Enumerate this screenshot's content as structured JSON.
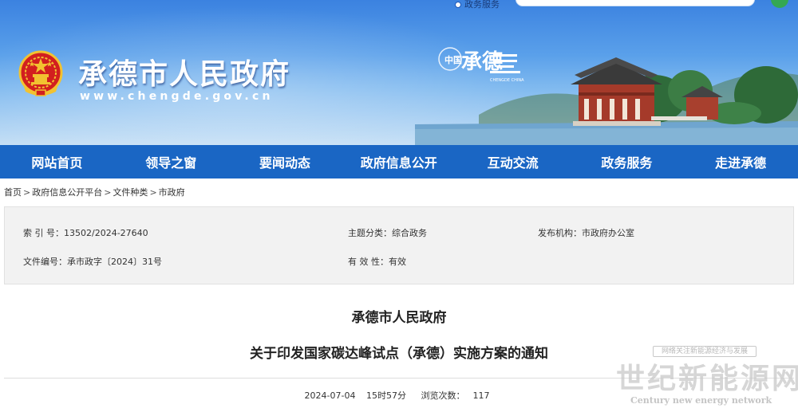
{
  "header": {
    "site_title": "承德市人民政府",
    "site_url": "www.chengde.gov.cn",
    "top_service_link": "政务服务",
    "brand_logo_text": "承德",
    "brand_logo_tag": "中国",
    "brand_logo_sub": "CHENGDE CHINA"
  },
  "nav": {
    "items": [
      {
        "label": "网站首页"
      },
      {
        "label": "领导之窗"
      },
      {
        "label": "要闻动态"
      },
      {
        "label": "政府信息公开"
      },
      {
        "label": "互动交流"
      },
      {
        "label": "政务服务"
      },
      {
        "label": "走进承德"
      }
    ]
  },
  "breadcrumb": {
    "items": [
      "首页",
      "政府信息公开平台",
      "文件种类",
      "市政府"
    ],
    "separator": ">"
  },
  "info": {
    "index_label": "索 引 号：",
    "index_value": "13502/2024-27640",
    "topic_label": "主题分类：",
    "topic_value": "综合政务",
    "issuer_label": "发布机构：",
    "issuer_value": "市政府办公室",
    "doc_no_label": "文件编号：",
    "doc_no_value": "承市政字〔2024〕31号",
    "validity_label": "有 效 性：",
    "validity_value": "有效"
  },
  "article": {
    "org": "承德市人民政府",
    "title": "关于印发国家碳达峰试点（承德）实施方案的通知",
    "date": "2024-07-04",
    "time": "15时57分",
    "views_label": "浏览次数：",
    "views": "117"
  },
  "watermark": {
    "tag": "网络关注新能源经济与发展",
    "name": "世纪新能源网",
    "english": "Century new energy network"
  },
  "colors": {
    "nav_bg": "#1a66c4",
    "banner_top": "#3b82e0",
    "emblem_red": "#d21f1f",
    "emblem_gold": "#f2c230"
  }
}
